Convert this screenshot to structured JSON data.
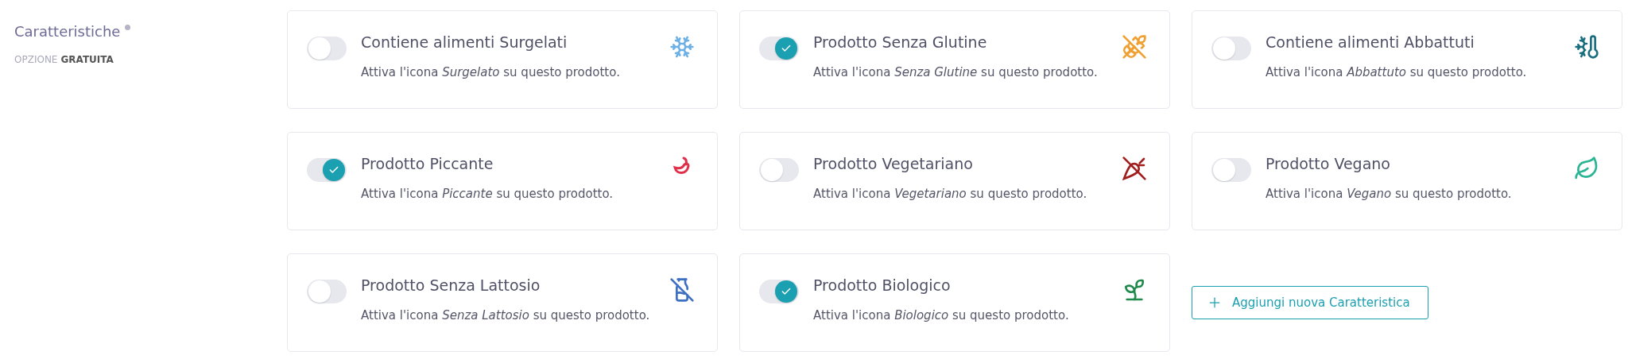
{
  "section": {
    "label": "Caratteristiche",
    "required_dot": true,
    "option_prefix": "OPZIONE",
    "option_value": "GRATUITA"
  },
  "cards": [
    {
      "title": "Contiene alimenti Surgelati",
      "description": "Attiva l'icona *Surgelato* su questo prodotto.",
      "on": false,
      "kind": "snowflake",
      "color": "#6cb0e6"
    },
    {
      "title": "Prodotto Senza Glutine",
      "description": "Attiva l'icona *Senza Glutine* su questo prodotto.",
      "on": true,
      "kind": "wheat-off",
      "color": "#f0a030"
    },
    {
      "title": "Contiene alimenti Abbattuti",
      "description": "Attiva l'icona *Abbattuto* su questo prodotto.",
      "on": false,
      "kind": "thermo-snow",
      "color": "#1a6e80"
    },
    {
      "title": "Prodotto Piccante",
      "description": "Attiva l'icona *Piccante* su questo prodotto.",
      "on": true,
      "kind": "pepper",
      "color": "#e0304a"
    },
    {
      "title": "Prodotto Vegetariano",
      "description": "Attiva l'icona *Vegetariano* su questo prodotto.",
      "on": false,
      "kind": "carrot-off",
      "color": "#a01e1e"
    },
    {
      "title": "Prodotto Vegano",
      "description": "Attiva l'icona *Vegano* su questo prodotto.",
      "on": false,
      "kind": "leaf",
      "color": "#2bb594"
    },
    {
      "title": "Prodotto Senza Lattosio",
      "description": "Attiva l'icona *Senza Lattosio* su questo prodotto.",
      "on": false,
      "kind": "milk-off",
      "color": "#3d6fc2"
    },
    {
      "title": "Prodotto Biologico",
      "description": "Attiva l'icona *Biologico* su questo prodotto.",
      "on": true,
      "kind": "sprout",
      "color": "#1f8a4c"
    }
  ],
  "add_button": {
    "label": "Aggiungi nuova Caratteristica"
  }
}
